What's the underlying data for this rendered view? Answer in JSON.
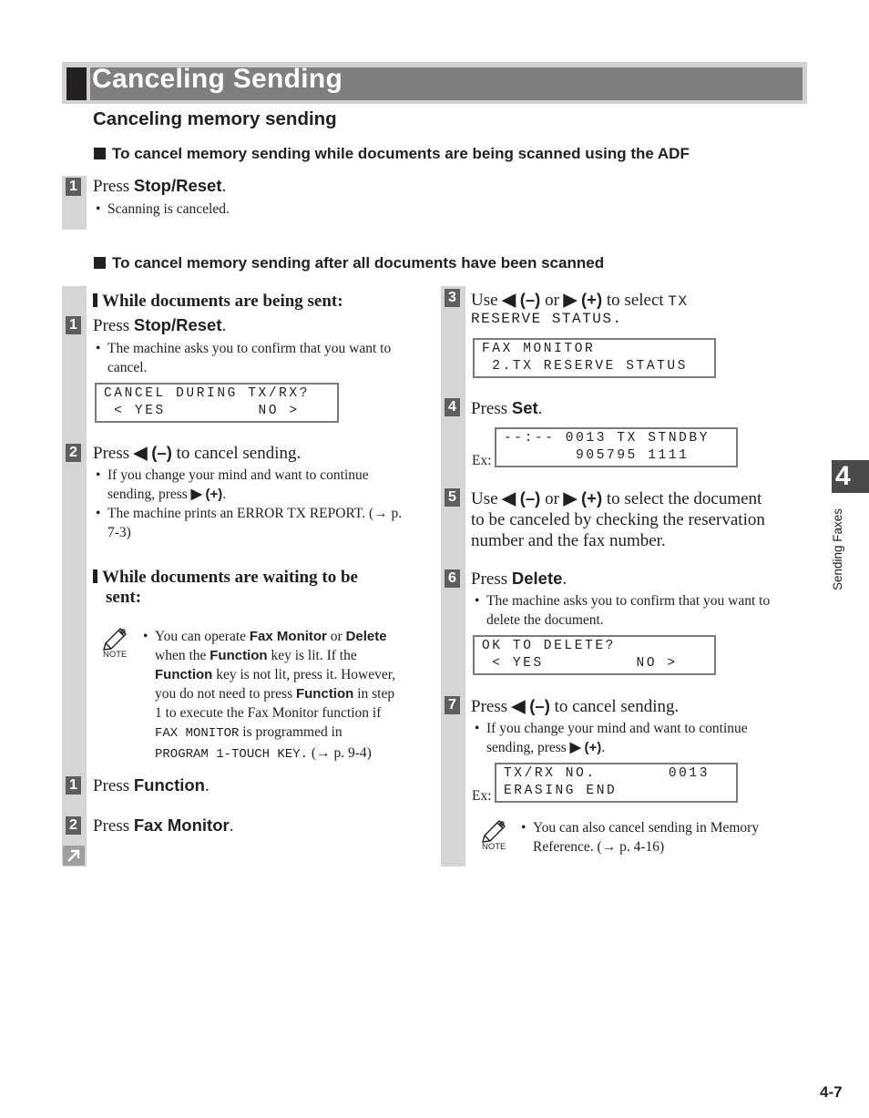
{
  "page": {
    "title": "Canceling Sending",
    "subtitle": "Canceling memory sending",
    "chapter_tab": "4",
    "chapter_label": "Sending Faxes",
    "page_number": "4-7"
  },
  "section_adf": {
    "heading": "To cancel memory sending while documents are being scanned using the ADF",
    "steps": [
      {
        "number": "1",
        "prefix": "Press ",
        "key": "Stop/Reset",
        "suffix": ".",
        "bullets": [
          "Scanning is canceled."
        ]
      }
    ]
  },
  "section_after": {
    "heading": "To cancel memory sending after all documents have been scanned",
    "while_sent": {
      "heading": "While documents are being sent:",
      "step1": {
        "number": "1",
        "prefix": "Press ",
        "key": "Stop/Reset",
        "suffix": ".",
        "bullet": "The machine asks you to confirm that you want to cancel."
      },
      "lcd1": {
        "line1": "CANCEL DURING TX/RX?",
        "line2": " < YES         NO >"
      },
      "step2": {
        "number": "2",
        "prefix": "Press ",
        "arrow": "◀",
        "key": "(–)",
        "suffix": " to cancel sending.",
        "bullet1_a": "If you change your mind and want to continue sending, press ",
        "bullet1_arrow": "▶",
        "bullet1_key": "(+)",
        "bullet1_end": ".",
        "bullet2": "The machine prints an ERROR TX REPORT. (→ p. 7-3)"
      }
    },
    "while_waiting": {
      "heading_line1": "While documents are waiting to be",
      "heading_line2": "sent:",
      "note": {
        "label": "NOTE",
        "t1": "You can operate ",
        "k1": "Fax Monitor",
        "t2": " or ",
        "k2": "Delete",
        "t3": "when the ",
        "k3": "Function",
        "t4": " key is lit. If the",
        "k4": "Function",
        "t5": " key is not lit, press it. However,",
        "t6": "you do not need to press ",
        "k5": "Function",
        "t7": " in step",
        "t8": "1 to execute the Fax Monitor function if",
        "m1": "FAX MONITOR",
        "t9": " is programmed in",
        "m2": "PROGRAM 1-TOUCH KEY.",
        "t10": " (→ p. 9-4)"
      },
      "step1": {
        "number": "1",
        "prefix": "Press ",
        "key": "Function",
        "suffix": "."
      },
      "step2": {
        "number": "2",
        "prefix": "Press ",
        "key": "Fax Monitor",
        "suffix": "."
      },
      "continue_icon": "continue-arrow-icon"
    },
    "right": {
      "step3": {
        "number": "3",
        "a": "Use ",
        "arrow_l": "◀",
        "key_l": "(–)",
        "or": " or ",
        "arrow_r": "▶",
        "key_r": "(+)",
        "b": " to select ",
        "m1": "TX",
        "m2": "RESERVE STATUS."
      },
      "lcd3": {
        "line1": "FAX MONITOR",
        "line2": " 2.TX RESERVE STATUS"
      },
      "step4": {
        "number": "4",
        "prefix": "Press ",
        "key": "Set",
        "suffix": "."
      },
      "lcd4": {
        "ex": "Ex:",
        "line1": "--:-- 0013 TX STNDBY",
        "line2": "       905795 1111"
      },
      "step5": {
        "number": "5",
        "a": "Use ",
        "arrow_l": "◀",
        "key_l": "(–)",
        "or": " or ",
        "arrow_r": "▶",
        "key_r": "(+)",
        "b": " to select the document",
        "line2": "to be canceled by checking the reservation",
        "line3": "number and the fax number."
      },
      "step6": {
        "number": "6",
        "prefix": "Press ",
        "key": "Delete",
        "suffix": ".",
        "bullet": "The machine asks you to confirm that you want to delete the document."
      },
      "lcd6": {
        "line1": "OK TO DELETE?",
        "line2": " < YES         NO >"
      },
      "step7": {
        "number": "7",
        "prefix": "Press ",
        "arrow": "◀",
        "key": "(–)",
        "suffix": " to cancel sending.",
        "bullet_a": "If you change your mind and want to continue sending, press ",
        "bullet_arrow": "▶",
        "bullet_key": "(+)",
        "bullet_end": "."
      },
      "lcd7": {
        "ex": "Ex:",
        "line1": "TX/RX NO.       0013",
        "line2": "ERASING END"
      },
      "note": {
        "label": "NOTE",
        "text": "You can also cancel sending in Memory Reference. (→ p. 4-16)"
      }
    }
  }
}
